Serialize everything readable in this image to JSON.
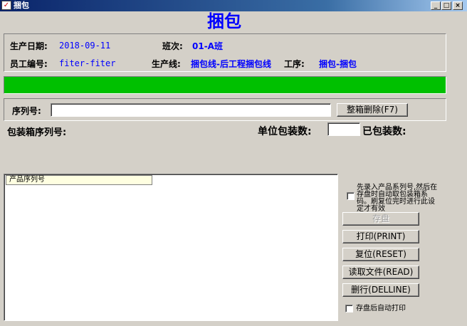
{
  "window": {
    "title": "捆包",
    "minimize": "_",
    "maximize": "□",
    "close": "×"
  },
  "heading": "捆包",
  "info": {
    "date_label": "生产日期:",
    "date_value": "2018-09-11",
    "shift_label": "班次:",
    "shift_value": "01-A班",
    "employee_label": "员工编号:",
    "employee_value": "fiter-fiter",
    "line_label": "生产线:",
    "line_value": "捆包线-后工程捆包线",
    "process_label": "工序:",
    "process_value": "捆包-捆包"
  },
  "status_bar_color": "#00c000",
  "serial": {
    "label": "序列号:",
    "value": "",
    "delete_box_button": "整箱删除(F7)"
  },
  "packing": {
    "box_serial_label": "包装箱序列号:",
    "box_serial_value": "",
    "unit_qty_label": "单位包装数:",
    "unit_qty_value": "",
    "packed_qty_label": "已包装数:",
    "packed_qty_value": ""
  },
  "product_list": {
    "column_header": "产品序列号",
    "rows": []
  },
  "options": {
    "auto_link_text": "先录入产品系列号,然后在存盘时自动取包装箱系码。刷复位完时进行此设定才有效",
    "auto_link_checked": false,
    "auto_print_text": "存盘后自动打印",
    "auto_print_checked": false
  },
  "buttons": {
    "save": "存盘",
    "print": "打印(PRINT)",
    "reset": "复位(RESET)",
    "read_file": "读取文件(READ)",
    "delete_line": "删行(DELLINE)"
  }
}
